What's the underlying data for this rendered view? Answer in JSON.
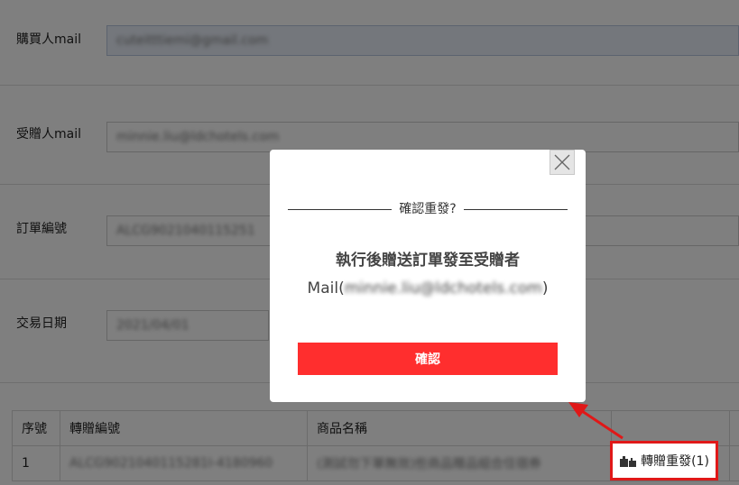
{
  "form": {
    "buyer_label": "購買人mail",
    "buyer_value": "cuteitttiemi@gmail.com",
    "recipient_label": "受贈人mail",
    "recipient_value": "minnie.liu@ldchotels.com",
    "order_label": "訂單編號",
    "order_value": "ALCG9021040115251",
    "date_label": "交易日期",
    "date_value": "2021/04/01"
  },
  "table": {
    "headers": [
      "序號",
      "轉贈編號",
      "商品名稱"
    ],
    "rows": [
      {
        "index": "1",
        "gift_no": "ALCG9021040115281I-4180960",
        "product": "(測試勿下單無效)些商品贈品組合住宿券"
      }
    ]
  },
  "modal": {
    "title": "確認重發?",
    "message_line1": "執行後贈送訂單發至受贈者",
    "message_prefix": "Mail(",
    "message_email": "minnie.liu@ldchotels.com",
    "message_suffix": ")",
    "confirm_label": "確認"
  },
  "resend": {
    "label": "轉贈重發(1)",
    "icon": "gift-icon"
  },
  "colors": {
    "accent_red": "#ff2e2e",
    "highlight_red": "#e01818",
    "overlay": "rgba(0,0,0,0.5)"
  }
}
